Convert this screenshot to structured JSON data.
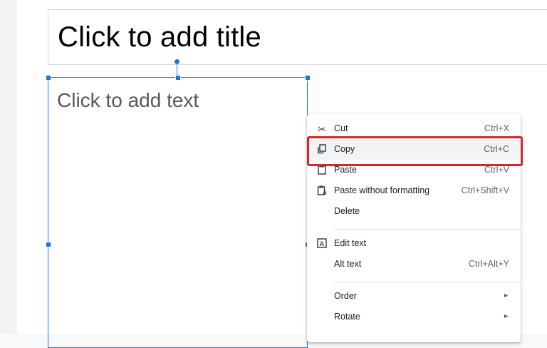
{
  "slide": {
    "title_placeholder": "Click to add title",
    "text_placeholder": "Click to add text"
  },
  "context_menu": {
    "items": [
      {
        "icon": "scissors-icon",
        "label": "Cut",
        "shortcut": "Ctrl+X"
      },
      {
        "icon": "copy-icon",
        "label": "Copy",
        "shortcut": "Ctrl+C"
      },
      {
        "icon": "clipboard-icon",
        "label": "Paste",
        "shortcut": "Ctrl+V"
      },
      {
        "icon": "paste-plain-icon",
        "label": "Paste without formatting",
        "shortcut": "Ctrl+Shift+V"
      },
      {
        "icon": "",
        "label": "Delete",
        "shortcut": ""
      },
      {
        "icon": "edit-text-icon",
        "label": "Edit text",
        "shortcut": ""
      },
      {
        "icon": "",
        "label": "Alt text",
        "shortcut": "Ctrl+Alt+Y"
      },
      {
        "icon": "",
        "label": "Order",
        "shortcut": ""
      },
      {
        "icon": "",
        "label": "Rotate",
        "shortcut": ""
      }
    ]
  },
  "colors": {
    "selection": "#1a73e8",
    "highlight": "#d9232d"
  }
}
